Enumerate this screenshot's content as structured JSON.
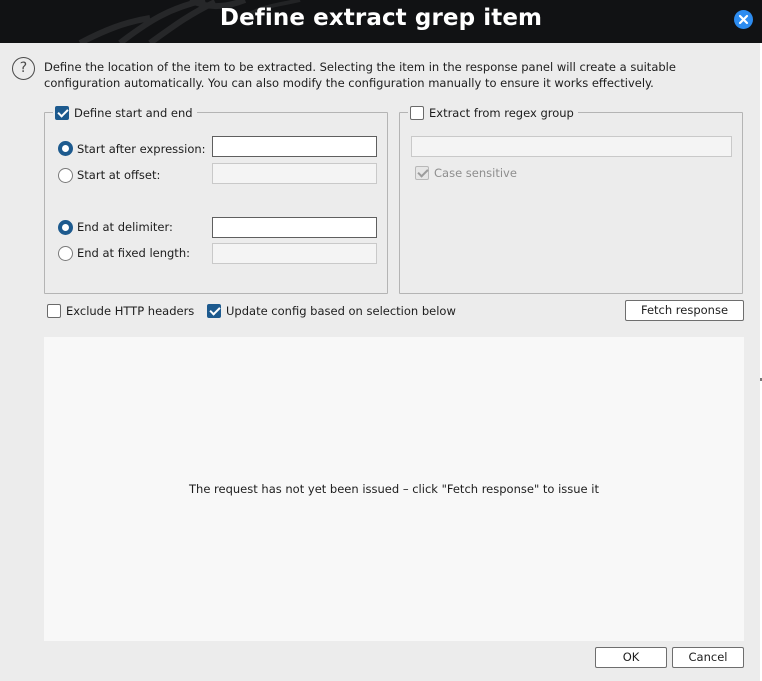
{
  "window": {
    "title": "Define extract grep item"
  },
  "intro": {
    "text": "Define the location of the item to be extracted. Selecting the item in the response panel will create a suitable configuration automatically. You can also modify the configuration manually to ensure it works effectively."
  },
  "start_end": {
    "label": "Define start and end",
    "checked": true,
    "start_after_label": "Start after expression:",
    "start_after_value": "",
    "start_offset_label": "Start at offset:",
    "start_offset_value": "",
    "end_delimiter_label": "End at delimiter:",
    "end_delimiter_value": "",
    "end_fixed_label": "End at fixed length:",
    "end_fixed_value": "",
    "start_mode_selected": "Start after expression:",
    "end_mode_selected": "End at delimiter:"
  },
  "regex": {
    "label": "Extract from regex group",
    "checked": false,
    "value": "",
    "case_sensitive_label": "Case sensitive",
    "case_sensitive_checked": true
  },
  "options": {
    "exclude_headers_label": "Exclude HTTP headers",
    "exclude_headers_checked": false,
    "update_config_label": "Update config based on selection below",
    "update_config_checked": true,
    "fetch_label": "Fetch response"
  },
  "response": {
    "message": "The request has not yet been issued – click \"Fetch response\" to issue it"
  },
  "footer": {
    "ok_label": "OK",
    "cancel_label": "Cancel"
  },
  "colors": {
    "accent": "#1d5a8e",
    "close_button": "#2d8cf0",
    "titlebar": "#111214",
    "dialog_bg": "#ececec"
  },
  "icons": [
    "close-icon",
    "help-icon"
  ]
}
